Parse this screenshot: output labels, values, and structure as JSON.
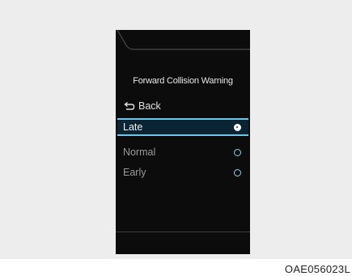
{
  "menu": {
    "title": "Forward Collision Warning",
    "back_label": "Back",
    "back_icon": "return-arrow-icon",
    "options": [
      {
        "label": "Late",
        "selected": true
      },
      {
        "label": "Normal",
        "selected": false
      },
      {
        "label": "Early",
        "selected": false
      }
    ]
  },
  "image_code": "OAE056023L",
  "colors": {
    "screen_background": "#0c0c0c",
    "highlight_border": "#6fc6e6",
    "highlight_fill": "#0a2434",
    "radio_ring": "#8fd3ec",
    "panel_background": "#ededed"
  }
}
